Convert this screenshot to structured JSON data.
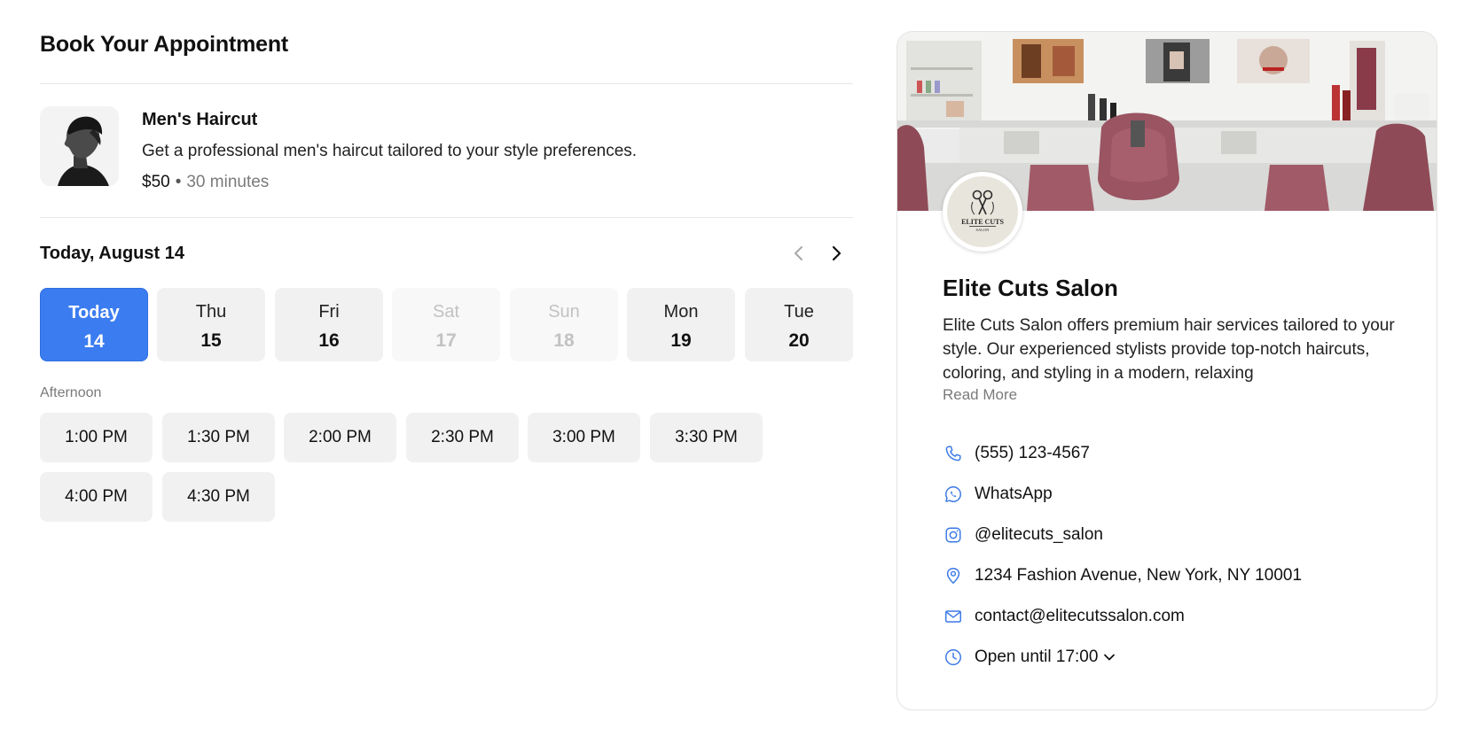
{
  "page": {
    "title": "Book Your Appointment"
  },
  "service": {
    "name": "Men's Haircut",
    "description": "Get a professional men's haircut tailored to your style preferences.",
    "price": "$50",
    "separator": "•",
    "duration": "30 minutes",
    "thumbnail_icon": "man-profile-photo"
  },
  "calendar": {
    "current_label": "Today, August 14",
    "prev_icon": "chevron-left-icon",
    "next_icon": "chevron-right-icon",
    "days": [
      {
        "name": "Today",
        "num": "14",
        "state": "selected"
      },
      {
        "name": "Thu",
        "num": "15",
        "state": "available"
      },
      {
        "name": "Fri",
        "num": "16",
        "state": "available"
      },
      {
        "name": "Sat",
        "num": "17",
        "state": "disabled"
      },
      {
        "name": "Sun",
        "num": "18",
        "state": "disabled"
      },
      {
        "name": "Mon",
        "num": "19",
        "state": "available"
      },
      {
        "name": "Tue",
        "num": "20",
        "state": "available"
      }
    ],
    "period": "Afternoon",
    "slots": [
      "1:00 PM",
      "1:30 PM",
      "2:00 PM",
      "2:30 PM",
      "3:00 PM",
      "3:30 PM",
      "4:00 PM",
      "4:30 PM"
    ]
  },
  "business": {
    "name": "Elite Cuts Salon",
    "description": "Elite Cuts Salon offers premium hair services tailored to your style. Our experienced stylists provide top-notch haircuts, coloring, and styling in a modern, relaxing",
    "read_more": "Read More",
    "logo_text": "ELITE CUTS",
    "logo_subtext": "SALON",
    "contacts": {
      "phone": "(555) 123-4567",
      "whatsapp": "WhatsApp",
      "instagram": "@elitecuts_salon",
      "address": "1234 Fashion Avenue, New York, NY 10001",
      "email": "contact@elitecutssalon.com",
      "hours": "Open until 17:00"
    }
  },
  "colors": {
    "accent": "#3b7cf0",
    "icon_blue": "#3a78e6",
    "chip_bg": "#f1f1f1",
    "muted_text": "#7a7a7a"
  }
}
